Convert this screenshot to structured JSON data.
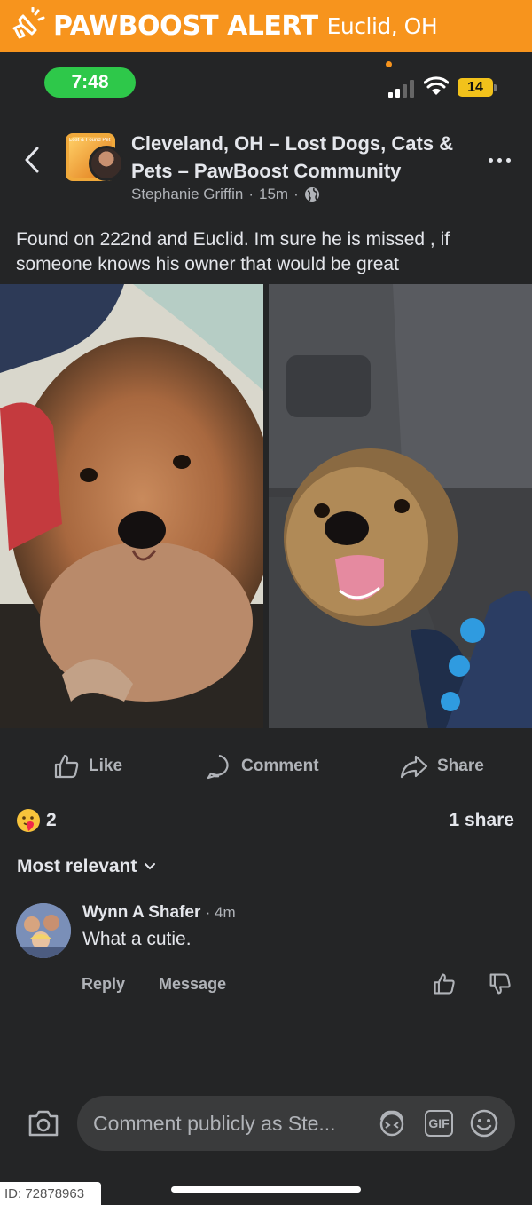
{
  "banner": {
    "brand": "PAWBOOST ALERT",
    "location": "Euclid, OH",
    "color": "#f7941d",
    "icon": "megaphone-icon"
  },
  "status": {
    "time": "7:48",
    "battery": "14"
  },
  "post": {
    "group_name": "Cleveland, OH – Lost Dogs, Cats & Pets – PawBoost Community",
    "group_avatar_text": "Lost & Found Pet Community",
    "author": "Stephanie Griffin",
    "time": "15m",
    "text": "Found on 222nd and Euclid. Im sure he is missed , if someone knows his owner that would be great"
  },
  "actions": {
    "like": "Like",
    "comment": "Comment",
    "share": "Share"
  },
  "stats": {
    "reactions": "2",
    "shares": "1 share"
  },
  "comments": {
    "sort_label": "Most relevant",
    "items": [
      {
        "author": "Wynn A Shafer",
        "time": "4m",
        "text": "What a cutie.",
        "reply": "Reply",
        "message": "Message"
      }
    ]
  },
  "composer": {
    "placeholder": "Comment publicly as Ste...",
    "gif": "GIF"
  },
  "footer": {
    "id": "ID: 72878963"
  }
}
